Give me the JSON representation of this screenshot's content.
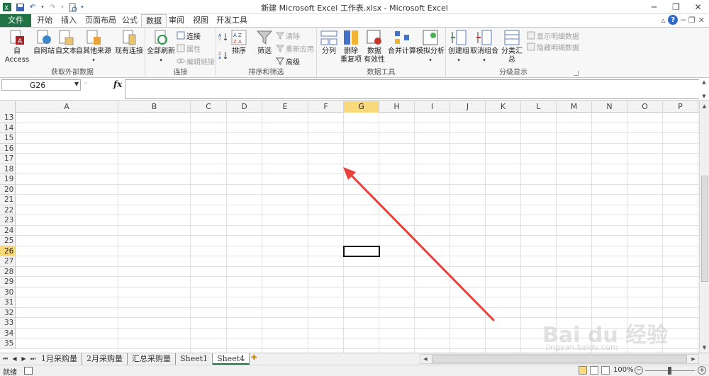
{
  "window": {
    "title": "新建 Microsoft Excel 工作表.xlsx - Microsoft Excel"
  },
  "tabs": [
    "文件",
    "开始",
    "插入",
    "页面布局",
    "公式",
    "数据",
    "审阅",
    "视图",
    "开发工具"
  ],
  "active_tab": "数据",
  "ribbon": {
    "get_external": {
      "label": "获取外部数据",
      "buttons": [
        "自 Access",
        "自网站",
        "自文本",
        "自其他来源",
        "现有连接"
      ]
    },
    "connections": {
      "label": "连接",
      "refresh_all": "全部刷新",
      "connections": "连接",
      "properties": "属性",
      "edit_links": "编辑链接"
    },
    "sort_filter": {
      "label": "排序和筛选",
      "sort": "排序",
      "filter": "筛选",
      "clear": "清除",
      "reapply": "重新应用",
      "advanced": "高级"
    },
    "data_tools": {
      "label": "数据工具",
      "text_to_columns": "分列",
      "remove_dupes_1": "删除",
      "remove_dupes_2": "重复项",
      "validation_1": "数据",
      "validation_2": "有效性",
      "consolidate": "合并计算",
      "whatif": "模拟分析"
    },
    "outline": {
      "label": "分级显示",
      "group": "创建组",
      "ungroup": "取消组合",
      "subtotal": "分类汇总",
      "show_detail": "显示明细数据",
      "hide_detail": "隐藏明细数据"
    }
  },
  "name_box": "G26",
  "fx_label": "fx",
  "columns": [
    "A",
    "B",
    "C",
    "D",
    "E",
    "F",
    "G",
    "H",
    "I",
    "J",
    "K",
    "L",
    "M",
    "N",
    "O",
    "P"
  ],
  "selected_column": "G",
  "rows": [
    "13",
    "14",
    "15",
    "16",
    "17",
    "18",
    "19",
    "20",
    "21",
    "22",
    "23",
    "24",
    "25",
    "26",
    "27",
    "28",
    "29",
    "30",
    "31",
    "32",
    "33",
    "34",
    "35"
  ],
  "selected_row": "26",
  "sheet_tabs": [
    "1月采购量",
    "2月采购量",
    "汇总采购量",
    "Sheet1",
    "Sheet4"
  ],
  "active_sheet": "Sheet4",
  "status": {
    "ready": "就绪",
    "zoom": "100%"
  },
  "watermark": {
    "main": "Bai du 经验",
    "sub": "jingyan.baidu.com"
  },
  "colors": {
    "file_tab": "#217346",
    "selection_highlight": "#f9d97a",
    "annotation_arrow": "#e8403a"
  }
}
